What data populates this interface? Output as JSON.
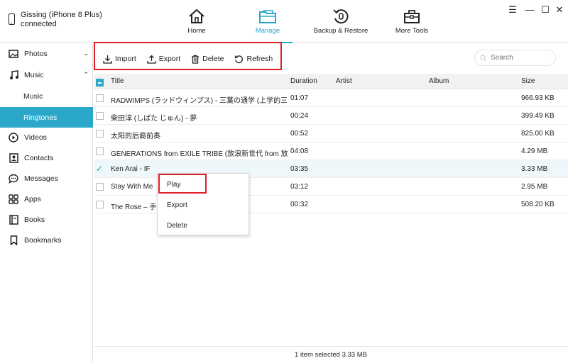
{
  "device": {
    "name": "Gissing (iPhone 8 Plus)",
    "status": "connected"
  },
  "nav": [
    {
      "label": "Home",
      "icon": "home-icon"
    },
    {
      "label": "Manage",
      "icon": "folder-icon",
      "active": true
    },
    {
      "label": "Backup & Restore",
      "icon": "backup-restore-icon"
    },
    {
      "label": "More Tools",
      "icon": "toolbox-icon"
    }
  ],
  "window_controls": {
    "menu": "☰",
    "minimize": "—",
    "maximize": "☐",
    "close": "✕"
  },
  "sidebar": {
    "items": [
      {
        "label": "Photos",
        "icon": "photos-icon"
      },
      {
        "label": "Music",
        "icon": "music-icon"
      },
      {
        "label": "Music",
        "icon": ""
      },
      {
        "label": "Ringtones",
        "icon": "",
        "active": true
      },
      {
        "label": "Videos",
        "icon": "videos-icon"
      },
      {
        "label": "Contacts",
        "icon": "contacts-icon"
      },
      {
        "label": "Messages",
        "icon": "messages-icon"
      },
      {
        "label": "Apps",
        "icon": "apps-icon"
      },
      {
        "label": "Books",
        "icon": "books-icon"
      },
      {
        "label": "Bookmarks",
        "icon": "bookmarks-icon"
      }
    ]
  },
  "toolbar": {
    "import": "Import",
    "export": "Export",
    "delete": "Delete",
    "refresh": "Refresh"
  },
  "search": {
    "placeholder": "Search"
  },
  "table": {
    "columns": {
      "title": "Title",
      "duration": "Duration",
      "artist": "Artist",
      "album": "Album",
      "size": "Size"
    },
    "rows": [
      {
        "title": "RADWIMPS (ラッドウィンプス) - 三葉の通学 (上学的三叶)",
        "duration": "01:07",
        "size": "966.93 KB"
      },
      {
        "title": "柴田淳 (しばた じゅん) - 夢",
        "duration": "00:24",
        "size": "399.49 KB"
      },
      {
        "title": "太阳的后裔前奏",
        "duration": "00:52",
        "size": "825.00 KB"
      },
      {
        "title": "GENERATIONS from EXILE TRIBE (放浪新世代 from 放浪一...",
        "duration": "04:08",
        "size": "4.29 MB"
      },
      {
        "title": "Ken Arai - IF",
        "duration": "03:35",
        "size": "3.33 MB",
        "selected": true
      },
      {
        "title": "Stay With Me",
        "duration": "03:12",
        "size": "2.95 MB"
      },
      {
        "title": "The Rose – 手嶌",
        "duration": "00:32",
        "size": "508.20 KB"
      }
    ]
  },
  "context_menu": {
    "play": "Play",
    "export": "Export",
    "delete": "Delete"
  },
  "status": {
    "text": "1 item selected 3.33 MB"
  },
  "colors": {
    "accent": "#2aa7c9",
    "highlight": "#e01e2b"
  }
}
